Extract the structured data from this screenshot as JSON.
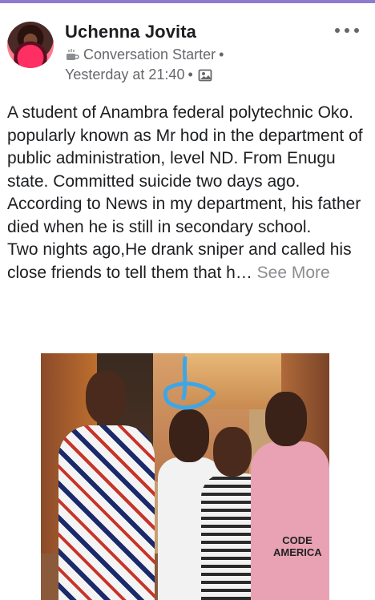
{
  "post": {
    "author": "Uchenna Jovita",
    "badge": "Conversation Starter",
    "timestamp": "Yesterday at 21:40",
    "text": "A student of Anambra federal polytechnic Oko.  popularly known as Mr hod in the department of public administration, level ND. From Enugu state. Committed suicide two days ago.  According to News in my department, his father died when he is still in secondary school.\n Two nights ago,He drank  sniper and called his close friends to tell them that h…",
    "see_more": "See More"
  },
  "photo": {
    "shirt_text_line1": "CODE",
    "shirt_text_line2": "AMERICA"
  },
  "colors": {
    "accent_top_bar": "#8e7bd0",
    "text_primary": "#1c1e21",
    "text_secondary": "#65676b",
    "see_more": "#8a8d91",
    "marker_blue": "#3fa6e6"
  },
  "icons": {
    "more": "more-options-icon",
    "badge": "coffee-cup-icon",
    "audience": "photo-album-icon"
  }
}
